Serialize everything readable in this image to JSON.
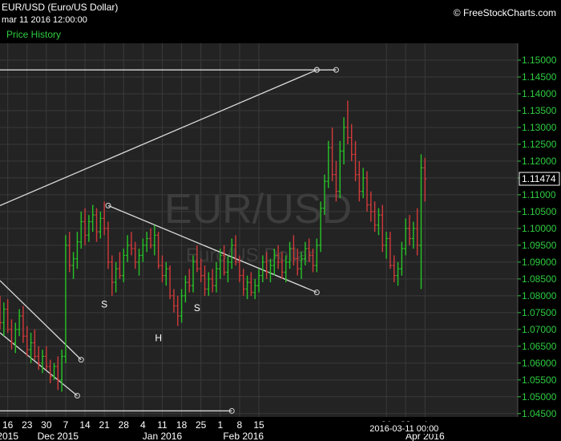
{
  "header": {
    "title": "EUR/USD (Euro/US Dollar)",
    "datetime": "mar 11 2016 12:00:00",
    "brand": "© FreeStockCharts.com",
    "study_label": "Price History"
  },
  "watermark": {
    "symbol": "EUR/USD",
    "name": "Euro/US Dollar"
  },
  "colors": {
    "background": "#000000",
    "plot_background": "#232323",
    "grid": "#3a3a3a",
    "up_bar": "#27c427",
    "down_bar": "#d23a3a",
    "axis_text": "#2ecc40",
    "trendline": "#d9d9d9"
  },
  "chart_data": {
    "type": "ohlc",
    "ylim": [
      1.044,
      1.155
    ],
    "x_index_range": [
      -8,
      126
    ],
    "yticks": [
      1.045,
      1.05,
      1.055,
      1.06,
      1.065,
      1.07,
      1.075,
      1.08,
      1.085,
      1.09,
      1.095,
      1.1,
      1.105,
      1.11,
      1.115,
      1.12,
      1.125,
      1.13,
      1.135,
      1.14,
      1.145,
      1.15
    ],
    "current_price": 1.11474,
    "current_price_label": "1.11474",
    "cursor_date_label": "2016-03-11 00:00",
    "day_labels": [
      {
        "label": "16",
        "i": -6
      },
      {
        "label": "23",
        "i": -1
      },
      {
        "label": "30",
        "i": 4
      },
      {
        "label": "7",
        "i": 9
      },
      {
        "label": "14",
        "i": 14
      },
      {
        "label": "21",
        "i": 19
      },
      {
        "label": "28",
        "i": 24
      },
      {
        "label": "4",
        "i": 29
      },
      {
        "label": "11",
        "i": 34
      },
      {
        "label": "18",
        "i": 39
      },
      {
        "label": "25",
        "i": 44
      },
      {
        "label": "1",
        "i": 49
      },
      {
        "label": "8",
        "i": 54
      },
      {
        "label": "15",
        "i": 59
      },
      {
        "label": "21",
        "i": 92
      },
      {
        "label": "28",
        "i": 97
      },
      {
        "label": "4",
        "i": 102
      }
    ],
    "month_labels": [
      {
        "label": "2015",
        "i": -6
      },
      {
        "label": "Dec 2015",
        "i": 7
      },
      {
        "label": "Jan 2016",
        "i": 34
      },
      {
        "label": "Feb 2016",
        "i": 55
      },
      {
        "label": "Apr 2016",
        "i": 102
      }
    ],
    "annotations": [
      {
        "text": "S",
        "i": 19,
        "y": 1.0765
      },
      {
        "text": "H",
        "i": 33,
        "y": 1.0665
      },
      {
        "text": "S",
        "i": 43,
        "y": 1.0755
      }
    ],
    "trendlines": [
      {
        "i1": -8,
        "y1": 1.1471,
        "i2": 74,
        "y2": 1.1471,
        "end_circle": true
      },
      {
        "i1": 74,
        "y1": 1.1471,
        "i2": 79,
        "y2": 1.1471,
        "end_circle": true
      },
      {
        "i1": -8,
        "y1": 1.1068,
        "i2": 74,
        "y2": 1.1471,
        "end_circle": true
      },
      {
        "i1": -8,
        "y1": 1.0458,
        "i2": 52,
        "y2": 1.0458,
        "end_circle": true
      },
      {
        "i1": 20,
        "y1": 1.1068,
        "i2": 74,
        "y2": 1.081,
        "start_circle": true,
        "end_circle": true
      },
      {
        "i1": -8,
        "y1": 1.0845,
        "i2": 13,
        "y2": 1.061,
        "end_circle": true
      },
      {
        "i1": -8,
        "y1": 1.069,
        "i2": 12,
        "y2": 1.0503,
        "end_circle": true
      }
    ],
    "series": [
      {
        "name": "EUR/USD",
        "ohlc": [
          [
            1.078,
            1.08,
            1.07,
            1.072
          ],
          [
            1.072,
            1.078,
            1.068,
            1.076
          ],
          [
            1.076,
            1.079,
            1.069,
            1.07
          ],
          [
            1.07,
            1.073,
            1.064,
            1.066
          ],
          [
            1.066,
            1.072,
            1.063,
            1.07
          ],
          [
            1.07,
            1.076,
            1.068,
            1.074
          ],
          [
            1.074,
            1.077,
            1.066,
            1.068
          ],
          [
            1.068,
            1.071,
            1.062,
            1.064
          ],
          [
            1.064,
            1.069,
            1.06,
            1.066
          ],
          [
            1.066,
            1.07,
            1.061,
            1.062
          ],
          [
            1.062,
            1.065,
            1.058,
            1.06
          ],
          [
            1.06,
            1.064,
            1.057,
            1.062
          ],
          [
            1.062,
            1.065,
            1.058,
            1.059
          ],
          [
            1.059,
            1.061,
            1.054,
            1.056
          ],
          [
            1.056,
            1.06,
            1.055,
            1.059
          ],
          [
            1.059,
            1.062,
            1.052,
            1.055
          ],
          [
            1.055,
            1.064,
            1.0515,
            1.062
          ],
          [
            1.062,
            1.098,
            1.06,
            1.095
          ],
          [
            1.095,
            1.099,
            1.087,
            1.089
          ],
          [
            1.089,
            1.093,
            1.085,
            1.091
          ],
          [
            1.091,
            1.099,
            1.088,
            1.096
          ],
          [
            1.096,
            1.105,
            1.094,
            1.102
          ],
          [
            1.102,
            1.106,
            1.095,
            1.098
          ],
          [
            1.098,
            1.104,
            1.096,
            1.102
          ],
          [
            1.102,
            1.107,
            1.099,
            1.104
          ],
          [
            1.104,
            1.106,
            1.096,
            1.099
          ],
          [
            1.099,
            1.105,
            1.097,
            1.103
          ],
          [
            1.103,
            1.108,
            1.098,
            1.1
          ],
          [
            1.1,
            1.102,
            1.088,
            1.09
          ],
          [
            1.09,
            1.092,
            1.08,
            1.084
          ],
          [
            1.084,
            1.09,
            1.081,
            1.088
          ],
          [
            1.088,
            1.093,
            1.085,
            1.086
          ],
          [
            1.086,
            1.094,
            1.084,
            1.092
          ],
          [
            1.092,
            1.098,
            1.09,
            1.095
          ],
          [
            1.095,
            1.099,
            1.092,
            1.094
          ],
          [
            1.094,
            1.096,
            1.088,
            1.09
          ],
          [
            1.09,
            1.094,
            1.086,
            1.092
          ],
          [
            1.092,
            1.097,
            1.09,
            1.095
          ],
          [
            1.095,
            1.099,
            1.093,
            1.097
          ],
          [
            1.097,
            1.1,
            1.094,
            1.095
          ],
          [
            1.095,
            1.101,
            1.092,
            1.098
          ],
          [
            1.098,
            1.099,
            1.088,
            1.089
          ],
          [
            1.089,
            1.092,
            1.084,
            1.086
          ],
          [
            1.086,
            1.09,
            1.083,
            1.088
          ],
          [
            1.088,
            1.089,
            1.079,
            1.08
          ],
          [
            1.08,
            1.082,
            1.075,
            1.077
          ],
          [
            1.077,
            1.08,
            1.071,
            1.074
          ],
          [
            1.074,
            1.082,
            1.072,
            1.08
          ],
          [
            1.08,
            1.086,
            1.078,
            1.084
          ],
          [
            1.084,
            1.088,
            1.081,
            1.083
          ],
          [
            1.083,
            1.092,
            1.081,
            1.09
          ],
          [
            1.09,
            1.095,
            1.087,
            1.088
          ],
          [
            1.088,
            1.091,
            1.084,
            1.086
          ],
          [
            1.086,
            1.089,
            1.08,
            1.082
          ],
          [
            1.082,
            1.087,
            1.08,
            1.085
          ],
          [
            1.085,
            1.088,
            1.081,
            1.083
          ],
          [
            1.083,
            1.09,
            1.081,
            1.088
          ],
          [
            1.088,
            1.094,
            1.085,
            1.092
          ],
          [
            1.092,
            1.095,
            1.086,
            1.087
          ],
          [
            1.087,
            1.092,
            1.084,
            1.09
          ],
          [
            1.09,
            1.097,
            1.088,
            1.095
          ],
          [
            1.095,
            1.098,
            1.089,
            1.09
          ],
          [
            1.09,
            1.092,
            1.084,
            1.086
          ],
          [
            1.086,
            1.088,
            1.08,
            1.082
          ],
          [
            1.082,
            1.086,
            1.079,
            1.084
          ],
          [
            1.084,
            1.087,
            1.08,
            1.081
          ],
          [
            1.081,
            1.085,
            1.079,
            1.083
          ],
          [
            1.083,
            1.088,
            1.081,
            1.086
          ],
          [
            1.086,
            1.092,
            1.084,
            1.09
          ],
          [
            1.09,
            1.093,
            1.085,
            1.087
          ],
          [
            1.087,
            1.091,
            1.084,
            1.089
          ],
          [
            1.089,
            1.094,
            1.086,
            1.092
          ],
          [
            1.092,
            1.095,
            1.088,
            1.09
          ],
          [
            1.09,
            1.093,
            1.085,
            1.087
          ],
          [
            1.087,
            1.092,
            1.084,
            1.09
          ],
          [
            1.09,
            1.096,
            1.088,
            1.094
          ],
          [
            1.094,
            1.098,
            1.089,
            1.091
          ],
          [
            1.091,
            1.094,
            1.086,
            1.088
          ],
          [
            1.088,
            1.093,
            1.085,
            1.091
          ],
          [
            1.091,
            1.096,
            1.089,
            1.094
          ],
          [
            1.094,
            1.097,
            1.09,
            1.092
          ],
          [
            1.092,
            1.094,
            1.087,
            1.089
          ],
          [
            1.089,
            1.097,
            1.087,
            1.095
          ],
          [
            1.095,
            1.108,
            1.093,
            1.106
          ],
          [
            1.106,
            1.116,
            1.104,
            1.114
          ],
          [
            1.114,
            1.126,
            1.112,
            1.124
          ],
          [
            1.124,
            1.13,
            1.114,
            1.116
          ],
          [
            1.116,
            1.12,
            1.108,
            1.111
          ],
          [
            1.111,
            1.126,
            1.109,
            1.123
          ],
          [
            1.123,
            1.133,
            1.119,
            1.13
          ],
          [
            1.13,
            1.138,
            1.125,
            1.127
          ],
          [
            1.127,
            1.131,
            1.12,
            1.122
          ],
          [
            1.122,
            1.126,
            1.114,
            1.116
          ],
          [
            1.116,
            1.12,
            1.108,
            1.111
          ],
          [
            1.111,
            1.118,
            1.109,
            1.115
          ],
          [
            1.115,
            1.117,
            1.105,
            1.107
          ],
          [
            1.107,
            1.111,
            1.102,
            1.105
          ],
          [
            1.105,
            1.108,
            1.099,
            1.101
          ],
          [
            1.101,
            1.106,
            1.098,
            1.104
          ],
          [
            1.104,
            1.107,
            1.093,
            1.095
          ],
          [
            1.095,
            1.099,
            1.091,
            1.097
          ],
          [
            1.097,
            1.099,
            1.088,
            1.089
          ],
          [
            1.089,
            1.092,
            1.084,
            1.086
          ],
          [
            1.086,
            1.09,
            1.083,
            1.088
          ],
          [
            1.088,
            1.096,
            1.086,
            1.094
          ],
          [
            1.094,
            1.103,
            1.092,
            1.1
          ],
          [
            1.1,
            1.104,
            1.095,
            1.097
          ],
          [
            1.097,
            1.102,
            1.094,
            1.1
          ],
          [
            1.1,
            1.106,
            1.092,
            1.095
          ],
          [
            1.095,
            1.122,
            1.082,
            1.118
          ],
          [
            1.118,
            1.121,
            1.108,
            1.1147
          ]
        ]
      }
    ]
  }
}
